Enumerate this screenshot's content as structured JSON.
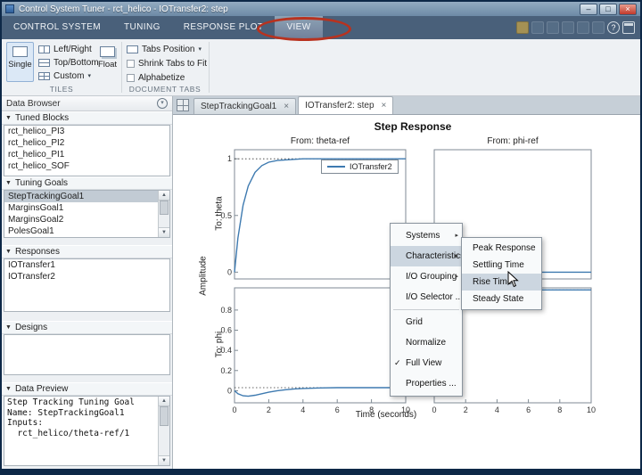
{
  "window": {
    "title": "Control System Tuner - rct_helico - IOTransfer2: step"
  },
  "icons": {
    "dropdown": "▾",
    "collapse_arrow": "▼",
    "scroll_up": "▲",
    "scroll_down": "▼",
    "close": "×",
    "check": "✓",
    "submenu_arrow": "▸",
    "help": "?",
    "minimize": "–",
    "maximize": "□",
    "window_close": "×"
  },
  "toolstrip": {
    "tabs": [
      "CONTROL SYSTEM",
      "TUNING",
      "RESPONSE PLOT",
      "VIEW"
    ],
    "selected_tab": "VIEW",
    "tiles": {
      "section_label": "TILES",
      "single_label": "Single",
      "left_right_label": "Left/Right",
      "top_bottom_label": "Top/Bottom",
      "custom_label": "Custom",
      "float_label": "Float"
    },
    "document_tabs": {
      "section_label": "DOCUMENT TABS",
      "tabs_position_label": "Tabs Position",
      "shrink_label": "Shrink Tabs to Fit",
      "alphabetize_label": "Alphabetize"
    }
  },
  "data_browser": {
    "title": "Data Browser",
    "tuned_blocks": {
      "title": "Tuned Blocks",
      "items": [
        "rct_helico_PI3",
        "rct_helico_PI2",
        "rct_helico_PI1",
        "rct_helico_SOF"
      ]
    },
    "tuning_goals": {
      "title": "Tuning Goals",
      "items": [
        "StepTrackingGoal1",
        "MarginsGoal1",
        "MarginsGoal2",
        "PolesGoal1"
      ],
      "selected_item": "StepTrackingGoal1"
    },
    "responses": {
      "title": "Responses",
      "items": [
        "IOTransfer1",
        "IOTransfer2"
      ]
    },
    "designs": {
      "title": "Designs"
    },
    "data_preview": {
      "title": "Data Preview",
      "lines": [
        "Step Tracking Tuning Goal",
        "Name: StepTrackingGoal1",
        "Inputs:",
        "  rct_helico/theta-ref/1"
      ]
    }
  },
  "documents": {
    "tabs": [
      "StepTrackingGoal1",
      "IOTransfer2: step"
    ],
    "active_tab": "IOTransfer2: step"
  },
  "context_menu": {
    "items": [
      "Systems",
      "Characteristics",
      "I/O Grouping",
      "I/O Selector ...",
      "Grid",
      "Normalize",
      "Full View",
      "Properties ..."
    ],
    "highlighted_item": "Characteristics",
    "checked_item": "Full View",
    "submenu_items": [
      "Peak Response",
      "Settling Time",
      "Rise Time",
      "Steady State"
    ],
    "submenu_highlighted": "Rise Time"
  },
  "chart_data": {
    "type": "line",
    "title": "Step Response",
    "xlabel": "Time (seconds)",
    "ylabel": "Amplitude",
    "column_headers": [
      "From: theta-ref",
      "From: phi-ref"
    ],
    "row_headers": [
      "To: theta",
      "To: phi"
    ],
    "legend": [
      "IOTransfer2"
    ],
    "line_color": "#3e7ab0",
    "x": [
      0,
      0.2,
      0.5,
      0.8,
      1.2,
      1.6,
      2,
      2.5,
      3,
      3.5,
      4,
      5,
      6,
      7,
      8,
      9,
      10
    ],
    "subplots": [
      {
        "from": "theta-ref",
        "to": "theta",
        "xlim": [
          0,
          10
        ],
        "ylim": [
          -0.06,
          1.08
        ],
        "xticks": [],
        "yticks": [
          0,
          0.5,
          1
        ],
        "steady_state": 1,
        "y": [
          0,
          0.3,
          0.59,
          0.76,
          0.88,
          0.94,
          0.97,
          0.985,
          0.99,
          0.995,
          1,
          1,
          1,
          1,
          1,
          1,
          1
        ]
      },
      {
        "from": "phi-ref",
        "to": "theta",
        "xlim": [
          0,
          10
        ],
        "ylim": [
          -0.06,
          1.08
        ],
        "xticks": [],
        "yticks": [],
        "steady_state": 0,
        "y": [
          0,
          -0.008,
          -0.012,
          -0.01,
          -0.005,
          0,
          0.003,
          0.004,
          0.003,
          0.002,
          0.001,
          0,
          0,
          0,
          0,
          0,
          0
        ]
      },
      {
        "from": "theta-ref",
        "to": "phi",
        "xlim": [
          0,
          10
        ],
        "ylim": [
          -0.12,
          1.02
        ],
        "xticks": [
          0,
          2,
          4,
          6,
          8,
          10
        ],
        "yticks": [
          0,
          0.2,
          0.4,
          0.6,
          0.8
        ],
        "steady_state": 0.03,
        "y": [
          0,
          -0.03,
          -0.05,
          -0.055,
          -0.045,
          -0.03,
          -0.015,
          0,
          0.01,
          0.018,
          0.022,
          0.028,
          0.03,
          0.03,
          0.03,
          0.03,
          0.03
        ]
      },
      {
        "from": "phi-ref",
        "to": "phi",
        "xlim": [
          0,
          10
        ],
        "ylim": [
          -0.12,
          1.02
        ],
        "xticks": [
          0,
          2,
          4,
          6,
          8,
          10
        ],
        "yticks": [],
        "steady_state": 1,
        "y": [
          0,
          0.22,
          0.48,
          0.65,
          0.8,
          0.89,
          0.94,
          0.97,
          0.985,
          0.99,
          0.995,
          1,
          1,
          1,
          1,
          1,
          1
        ]
      }
    ]
  }
}
